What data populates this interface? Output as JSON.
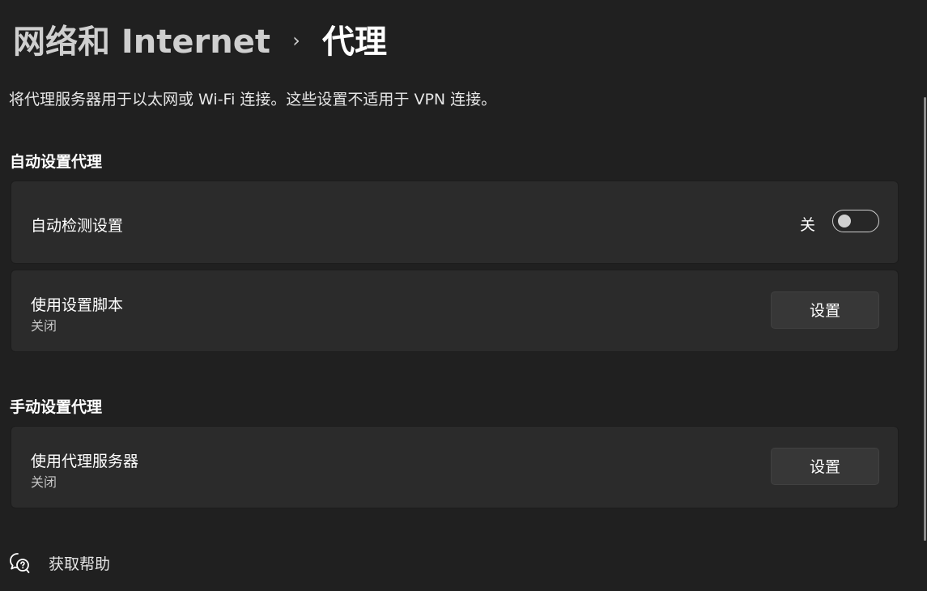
{
  "header": {
    "parent": "网络和 Internet",
    "separator": "›",
    "current": "代理"
  },
  "description": "将代理服务器用于以太网或 Wi-Fi 连接。这些设置不适用于 VPN 连接。",
  "auto_section": {
    "title": "自动设置代理",
    "auto_detect": {
      "label": "自动检测设置",
      "state_label": "关",
      "enabled": false
    },
    "setup_script": {
      "label": "使用设置脚本",
      "status": "关闭",
      "button_label": "设置"
    }
  },
  "manual_section": {
    "title": "手动设置代理",
    "proxy_server": {
      "label": "使用代理服务器",
      "status": "关闭",
      "button_label": "设置"
    }
  },
  "help": {
    "label": "获取帮助",
    "icon": "help-chat-icon"
  },
  "colors": {
    "background": "#202020",
    "card": "#2b2b2b",
    "button": "#373737"
  }
}
